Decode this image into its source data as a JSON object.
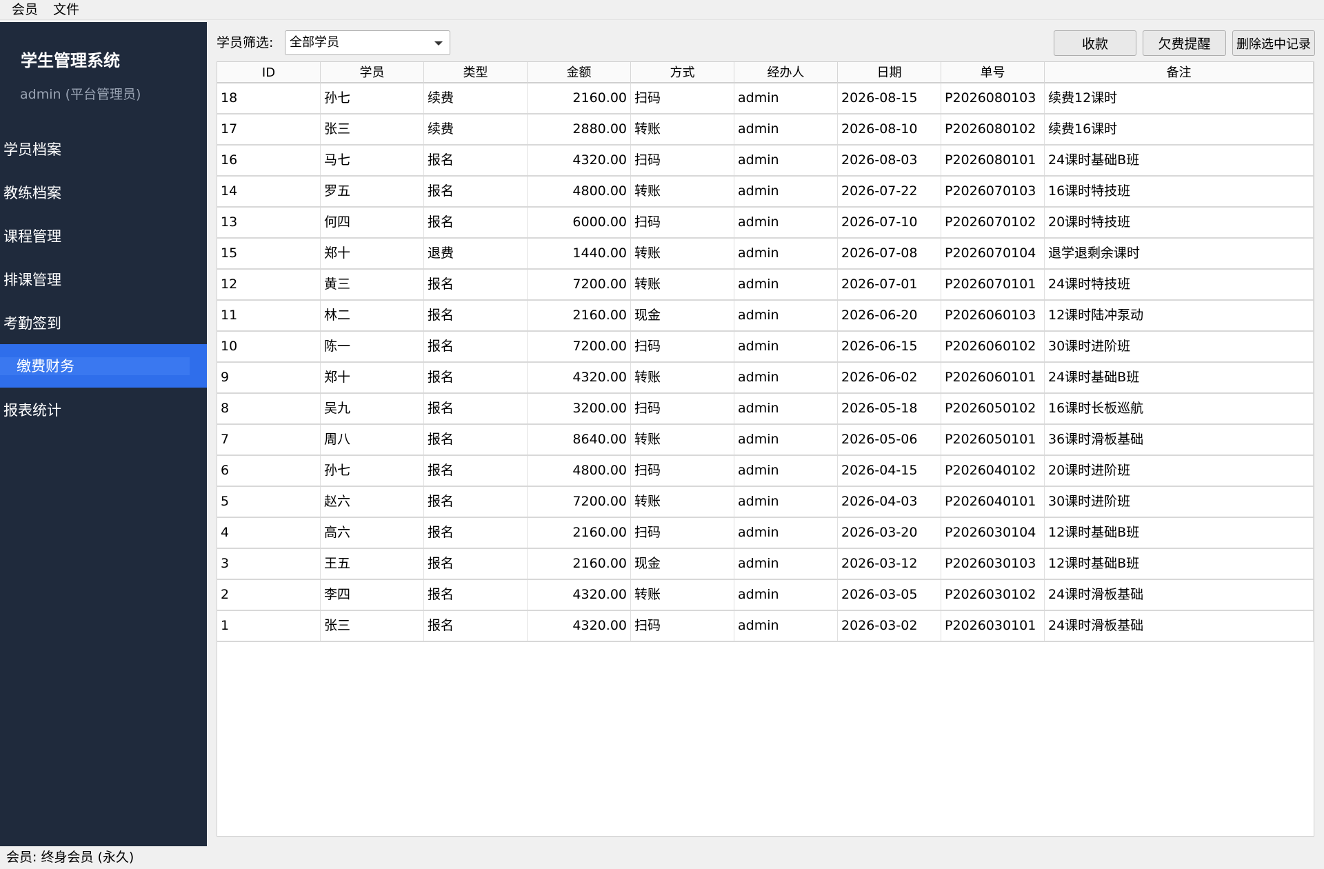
{
  "menu": [
    "会员",
    "文件"
  ],
  "sidebar": {
    "title": "学生管理系统",
    "user": "admin (平台管理员)",
    "items": [
      {
        "label": "学员档案"
      },
      {
        "label": "教练档案"
      },
      {
        "label": "课程管理"
      },
      {
        "label": "排课管理"
      },
      {
        "label": "考勤签到"
      },
      {
        "label": "缴费财务",
        "active": true
      },
      {
        "label": "报表统计"
      }
    ],
    "accent": "#2f6eeb",
    "background": "#1f2a3c"
  },
  "toolbar": {
    "filter_label": "学员筛选:",
    "filter_value": "全部学员",
    "collect_label": "收款",
    "remind_label": "欠费提醒",
    "delete_label": "删除选中记录"
  },
  "table": {
    "headers": [
      "ID",
      "学员",
      "类型",
      "金额",
      "方式",
      "经办人",
      "日期",
      "单号",
      "备注"
    ],
    "rows": [
      [
        "18",
        "孙七",
        "续费",
        "2160.00",
        "扫码",
        "admin",
        "2026-08-15",
        "P2026080103",
        "续费12课时"
      ],
      [
        "17",
        "张三",
        "续费",
        "2880.00",
        "转账",
        "admin",
        "2026-08-10",
        "P2026080102",
        "续费16课时"
      ],
      [
        "16",
        "马七",
        "报名",
        "4320.00",
        "扫码",
        "admin",
        "2026-08-03",
        "P2026080101",
        "24课时基础B班"
      ],
      [
        "14",
        "罗五",
        "报名",
        "4800.00",
        "转账",
        "admin",
        "2026-07-22",
        "P2026070103",
        "16课时特技班"
      ],
      [
        "13",
        "何四",
        "报名",
        "6000.00",
        "扫码",
        "admin",
        "2026-07-10",
        "P2026070102",
        "20课时特技班"
      ],
      [
        "15",
        "郑十",
        "退费",
        "1440.00",
        "转账",
        "admin",
        "2026-07-08",
        "P2026070104",
        "退学退剩余课时"
      ],
      [
        "12",
        "黄三",
        "报名",
        "7200.00",
        "转账",
        "admin",
        "2026-07-01",
        "P2026070101",
        "24课时特技班"
      ],
      [
        "11",
        "林二",
        "报名",
        "2160.00",
        "现金",
        "admin",
        "2026-06-20",
        "P2026060103",
        "12课时陆冲泵动"
      ],
      [
        "10",
        "陈一",
        "报名",
        "7200.00",
        "扫码",
        "admin",
        "2026-06-15",
        "P2026060102",
        "30课时进阶班"
      ],
      [
        "9",
        "郑十",
        "报名",
        "4320.00",
        "转账",
        "admin",
        "2026-06-02",
        "P2026060101",
        "24课时基础B班"
      ],
      [
        "8",
        "吴九",
        "报名",
        "3200.00",
        "扫码",
        "admin",
        "2026-05-18",
        "P2026050102",
        "16课时长板巡航"
      ],
      [
        "7",
        "周八",
        "报名",
        "8640.00",
        "转账",
        "admin",
        "2026-05-06",
        "P2026050101",
        "36课时滑板基础"
      ],
      [
        "6",
        "孙七",
        "报名",
        "4800.00",
        "扫码",
        "admin",
        "2026-04-15",
        "P2026040102",
        "20课时进阶班"
      ],
      [
        "5",
        "赵六",
        "报名",
        "7200.00",
        "转账",
        "admin",
        "2026-04-03",
        "P2026040101",
        "30课时进阶班"
      ],
      [
        "4",
        "高六",
        "报名",
        "2160.00",
        "扫码",
        "admin",
        "2026-03-20",
        "P2026030104",
        "12课时基础B班"
      ],
      [
        "3",
        "王五",
        "报名",
        "2160.00",
        "现金",
        "admin",
        "2026-03-12",
        "P2026030103",
        "12课时基础B班"
      ],
      [
        "2",
        "李四",
        "报名",
        "4320.00",
        "转账",
        "admin",
        "2026-03-05",
        "P2026030102",
        "24课时滑板基础"
      ],
      [
        "1",
        "张三",
        "报名",
        "4320.00",
        "扫码",
        "admin",
        "2026-03-02",
        "P2026030101",
        "24课时滑板基础"
      ]
    ]
  },
  "status": "会员: 终身会员 (永久)"
}
